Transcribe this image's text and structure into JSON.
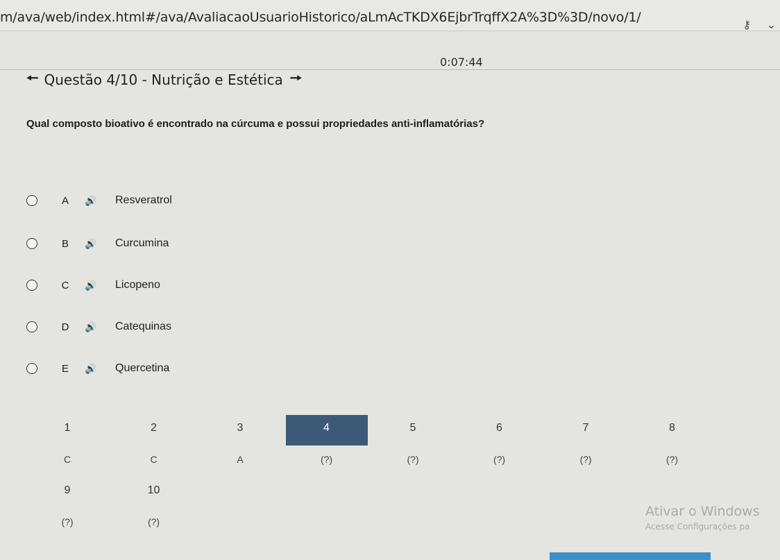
{
  "browser": {
    "url": "m/ava/web/index.html#/ava/AvaliacaoUsuarioHistorico/aLmAcTKDX6EjbrTrqffX2A%3D%3D/novo/1/"
  },
  "quiz": {
    "timer": "0:07:44",
    "title": "Questão 4/10 - Nutrição e Estética",
    "question": "Qual composto bioativo é encontrado na cúrcuma e possui propriedades anti-inflamatórias?",
    "options": [
      {
        "letter": "A",
        "text": "Resveratrol"
      },
      {
        "letter": "B",
        "text": "Curcumina"
      },
      {
        "letter": "C",
        "text": "Licopeno"
      },
      {
        "letter": "D",
        "text": "Catequinas"
      },
      {
        "letter": "E",
        "text": "Quercetina"
      }
    ]
  },
  "navigator": {
    "current": 4,
    "items": [
      {
        "num": "1",
        "answer": "C"
      },
      {
        "num": "2",
        "answer": "C"
      },
      {
        "num": "3",
        "answer": "A"
      },
      {
        "num": "4",
        "answer": "(?)"
      },
      {
        "num": "5",
        "answer": "(?)"
      },
      {
        "num": "6",
        "answer": "(?)"
      },
      {
        "num": "7",
        "answer": "(?)"
      },
      {
        "num": "8",
        "answer": "(?)"
      },
      {
        "num": "9",
        "answer": "(?)"
      },
      {
        "num": "10",
        "answer": "(?)"
      }
    ]
  },
  "watermark": {
    "line1": "Ativar o Windows",
    "line2": "Acesse Configurações pa"
  },
  "colors": {
    "current_cell": "#3c5a78",
    "taskbar_accent": "#3e8fc7"
  }
}
